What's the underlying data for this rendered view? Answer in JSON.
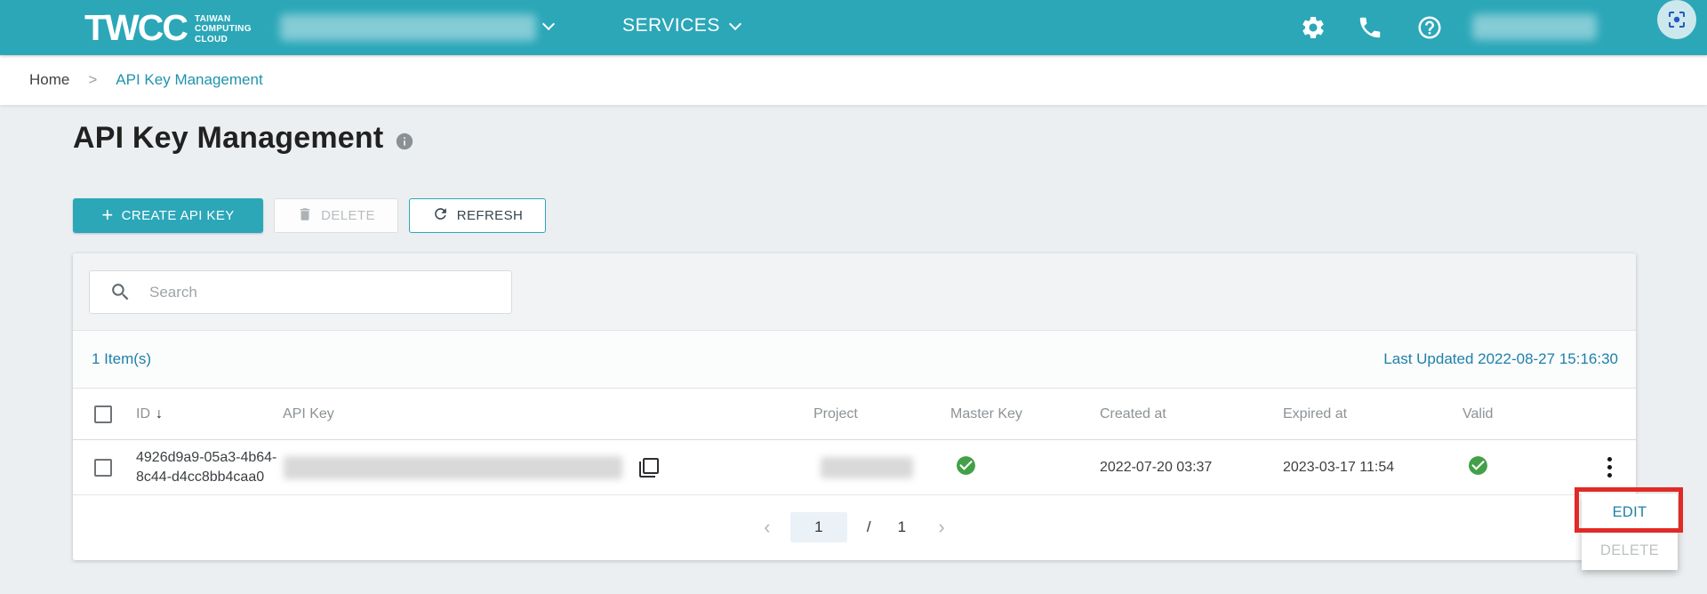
{
  "navbar": {
    "logo": {
      "brand": "TWCC",
      "tagline": [
        "TAIWAN",
        "COMPUTING",
        "CLOUD"
      ]
    },
    "services_label": "SERVICES"
  },
  "breadcrumb": {
    "home": "Home",
    "separator": ">",
    "current": "API Key Management"
  },
  "page": {
    "title": "API Key Management"
  },
  "toolbar": {
    "create_plus": "+",
    "create_label": "CREATE API KEY",
    "delete_label": "DELETE",
    "refresh_label": "REFRESH"
  },
  "search": {
    "placeholder": "Search"
  },
  "table": {
    "items_count": "1 Item(s)",
    "last_updated": "Last Updated 2022-08-27 15:16:30",
    "sort_indicator": "↓",
    "columns": [
      "ID",
      "API Key",
      "Project",
      "Master Key",
      "Created at",
      "Expired at",
      "Valid"
    ],
    "rows": [
      {
        "id": "4926d9a9-05a3-4b64-8c44-d4cc8bb4caa0",
        "api_key_blurred": true,
        "project_blurred": true,
        "master_key": true,
        "created_at": "2022-07-20 03:37",
        "expired_at": "2023-03-17 11:54",
        "valid": true
      }
    ]
  },
  "pagination": {
    "current": "1",
    "separator": "/",
    "total": "1",
    "prev": "‹",
    "next": "›"
  },
  "context_menu": {
    "items": [
      {
        "label": "EDIT",
        "enabled": true,
        "highlighted": true
      },
      {
        "label": "DELETE",
        "enabled": false
      }
    ]
  },
  "colors": {
    "brand_teal": "#2BA7B8",
    "link_blue": "#1F80A9",
    "success_green": "#43A047",
    "annotation_red": "#E12A26"
  }
}
